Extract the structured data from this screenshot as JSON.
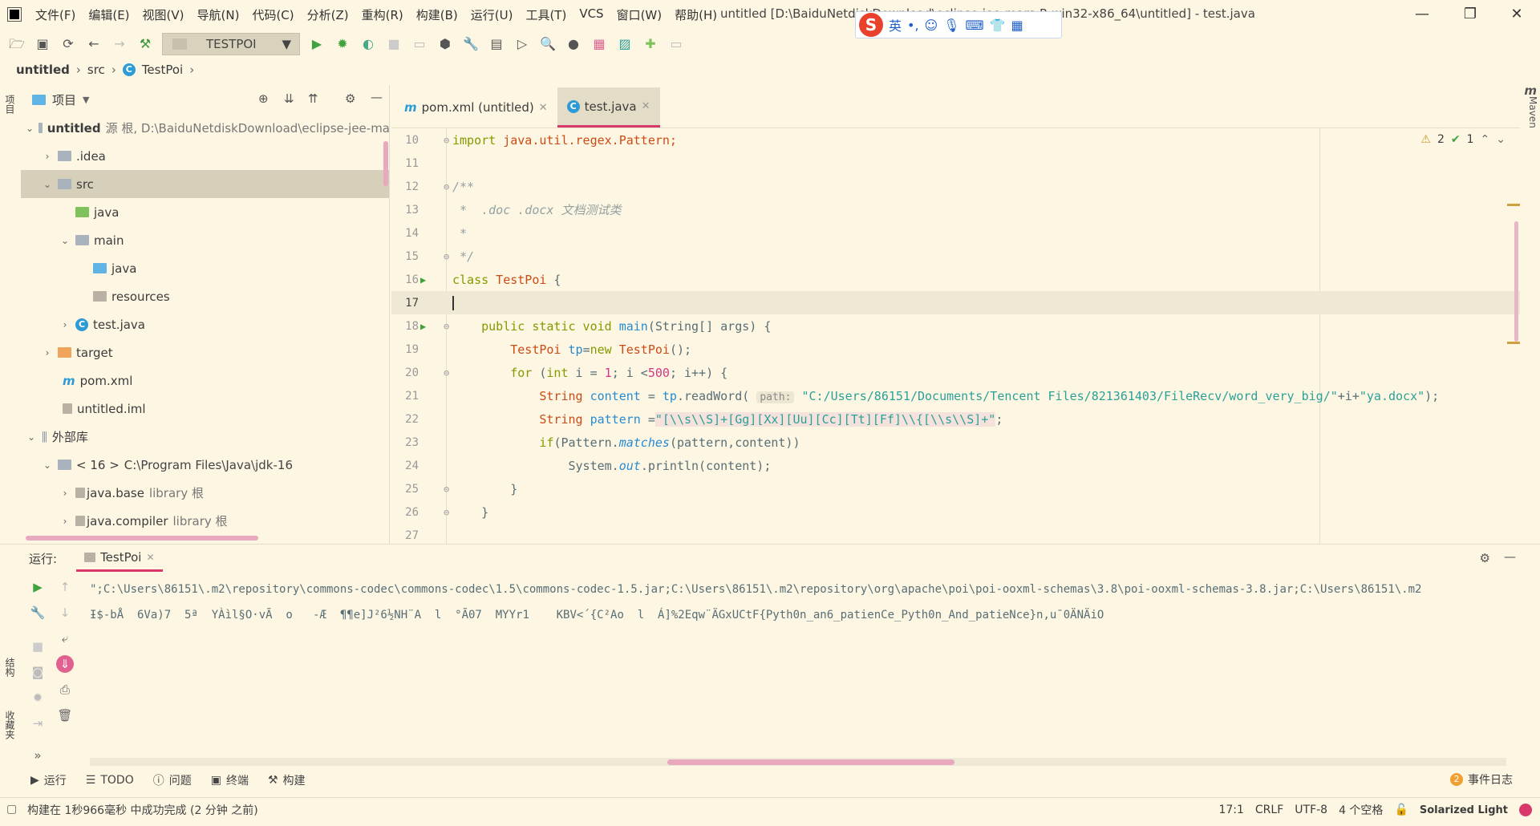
{
  "titlebar": {
    "menu": [
      "文件(F)",
      "编辑(E)",
      "视图(V)",
      "导航(N)",
      "代码(C)",
      "分析(Z)",
      "重构(R)",
      "构建(B)",
      "运行(U)",
      "工具(T)",
      "VCS",
      "窗口(W)",
      "帮助(H)"
    ],
    "window_title": "untitled [D:\\BaiduNetdiskDownload\\eclipse-jee-mars-R-win32-x86_64\\untitled] - test.java",
    "minimize": "—",
    "restore": "❐",
    "close": "✕"
  },
  "ime": {
    "logo": "S",
    "lang": "英",
    "punct": "•,",
    "emoji": "☺",
    "mic": "🎙",
    "keyboard": "⌨",
    "shirt": "👕",
    "grid": "▦"
  },
  "toolbar": {
    "run_config": "TESTPOI",
    "icons": [
      "folder-open-icon",
      "save-icon",
      "sync-icon",
      "back-icon",
      "forward-icon",
      "build-icon"
    ]
  },
  "breadcrumb": {
    "project": "untitled",
    "folder": "src",
    "class": "TestPoi"
  },
  "project_panel": {
    "title": "项目",
    "tree": [
      {
        "label": "untitled",
        "sub": "源 根, D:\\BaiduNetdiskDownload\\eclipse-jee-ma",
        "bold": true
      },
      {
        "label": ".idea"
      },
      {
        "label": "src"
      },
      {
        "label": "java"
      },
      {
        "label": "main"
      },
      {
        "label": "java"
      },
      {
        "label": "resources"
      },
      {
        "label": "test.java"
      },
      {
        "label": "target"
      },
      {
        "label": "pom.xml"
      },
      {
        "label": "untitled.iml"
      },
      {
        "label": "外部库"
      },
      {
        "label": "< 16 >",
        "sub": "C:\\Program Files\\Java\\jdk-16"
      },
      {
        "label": "java.base",
        "sub": "library 根"
      },
      {
        "label": "java.compiler",
        "sub": "library 根"
      }
    ]
  },
  "left_stripe": {
    "project": "项目",
    "structure": "结构",
    "favorites": "收藏夹"
  },
  "right_stripe": {
    "maven": "Maven",
    "maven_letter": "m"
  },
  "editor": {
    "tabs": [
      {
        "label": "pom.xml (untitled)",
        "icon": "m"
      },
      {
        "label": "test.java",
        "icon": "C"
      }
    ],
    "inspections": {
      "warnings": "2",
      "weak_warnings": "1"
    },
    "line_numbers": [
      "10",
      "11",
      "12",
      "13",
      "14",
      "15",
      "16",
      "17",
      "18",
      "19",
      "20",
      "21",
      "22",
      "23",
      "24",
      "25",
      "26",
      "27"
    ],
    "code": {
      "l10_kw": "import",
      "l10_rest": " java.util.regex.Pattern;",
      "l12": "/**",
      "l13": " *  .doc .docx 文档测试类",
      "l14": " *",
      "l15": " */",
      "l16_kw": "class",
      "l16_name": " TestPoi",
      "l16_rest": " {",
      "l18_kw": "    public static void",
      "l18_name": " main",
      "l18_rest": "(String[] args) {",
      "l19_type": "        TestPoi",
      "l19_var": " tp",
      "l19_eq": "=",
      "l19_new": "new",
      "l19_cls": " TestPoi",
      "l19_rest": "();",
      "l20_for": "        for",
      "l20_a": " (",
      "l20_int": "int",
      "l20_b": " i = ",
      "l20_one": "1",
      "l20_c": "; i <",
      "l20_500": "500",
      "l20_d": "; i++) {",
      "l21_type": "            String",
      "l21_var": " content",
      "l21_a": " = ",
      "l21_tp": "tp",
      "l21_m": ".readWord(",
      "l21_hint": "path:",
      "l21_str": "\"C:/Users/86151/Documents/Tencent Files/821361403/FileRecv/word_very_big/\"",
      "l21_b": "+i+",
      "l21_str2": "\"ya.docx\"",
      "l21_c": ");",
      "l22_type": "            String",
      "l22_var": " pattern",
      "l22_a": " =",
      "l22_str": "\"[\\\\s\\\\S]+[Gg][Xx][Uu][Cc][Tt][Ff]\\\\{[\\\\s\\\\S]+\"",
      "l22_b": ";",
      "l23_if": "            if",
      "l23_a": "(Pattern.",
      "l23_m": "matches",
      "l23_b": "(pattern,content))",
      "l24_a": "                System.",
      "l24_out": "out",
      "l24_b": ".println(content);",
      "l25": "        }",
      "l26": "    }"
    }
  },
  "run_panel": {
    "label": "运行:",
    "tab": "TestPoi",
    "console": [
      "\";C:\\Users\\86151\\.m2\\repository\\commons-codec\\commons-codec\\1.5\\commons-codec-1.5.jar;C:\\Users\\86151\\.m2\\repository\\org\\apache\\poi\\poi-ooxml-schemas\\3.8\\poi-ooxml-schemas-3.8.jar;C:\\Users\\86151\\.m2",
      "Ɨ$-bÅ  6Va)7  5ª  YÀìl§O·vÃ  o   -Æ  ¶¶e]J²6½NH¨A  l  °Ã07  MYYr1    KBV<´{C²Ao  l  Á]%2Eqw¨ÄGxUCtF{Pyth0n_an6_patienCe_Pyth0n_And_patieNce}n,u¯0ÄNÄiO"
    ]
  },
  "toolwindows": [
    "运行",
    "TODO",
    "问题",
    "终端",
    "构建"
  ],
  "event_log": {
    "count": "2",
    "label": "事件日志"
  },
  "status": {
    "message": "构建在 1秒966毫秒 中成功完成 (2 分钟 之前)",
    "position": "17:1",
    "line_sep": "CRLF",
    "encoding": "UTF-8",
    "indent": "4 个空格",
    "theme": "Solarized Light"
  }
}
